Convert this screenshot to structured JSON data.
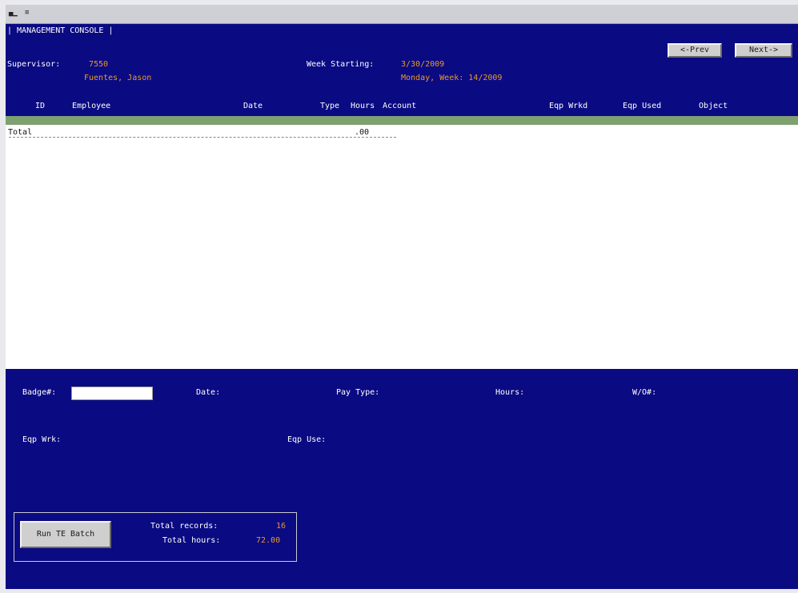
{
  "header": {
    "title": "| MANAGEMENT CONSOLE |",
    "prev_button": "<-Prev",
    "next_button": "Next->"
  },
  "supervisor": {
    "label": "Supervisor:",
    "id": "7550",
    "name": "Fuentes, Jason"
  },
  "week": {
    "label": "Week Starting:",
    "date": "3/30/2009",
    "day_week": "Monday, Week: 14/2009"
  },
  "table": {
    "columns": [
      "ID",
      "Employee",
      "Date",
      "Type",
      "Hours",
      "Account",
      "Eqp Wrkd",
      "Eqp Used",
      "Object"
    ],
    "total_label": "Total",
    "total_hours": ".00"
  },
  "form": {
    "badge_label": "Badge#:",
    "badge_value": "",
    "date_label": "Date:",
    "pay_type_label": "Pay Type:",
    "hours_label": "Hours:",
    "wo_label": "W/O#:",
    "eqp_wrk_label": "Eqp Wrk:",
    "eqp_use_label": "Eqp Use:"
  },
  "batch": {
    "run_button": "Run TE Batch",
    "records_label": "Total records:",
    "records_value": "16",
    "hours_label": "Total hours:",
    "hours_value": "72.00"
  },
  "colors": {
    "background": "#0a0a82",
    "value_text": "#e89a2a",
    "label_text": "#ffffff",
    "grid_header_bar": "#7fa071"
  },
  "icons": [
    "window-icon",
    "menu-icon"
  ]
}
